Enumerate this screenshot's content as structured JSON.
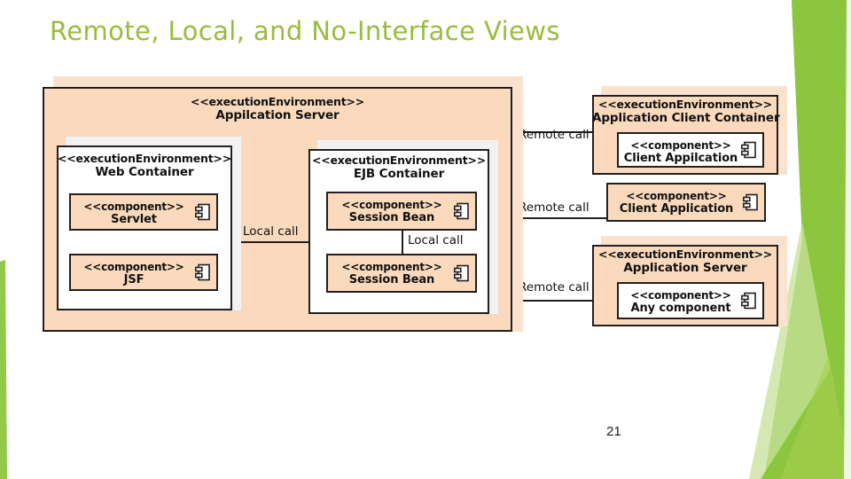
{
  "slide": {
    "title": "Remote, Local, and No-Interface Views",
    "page_number": "21",
    "title_color": "#9BBB3C",
    "node_fill": "#FAD9BC",
    "accent_green": "#8CC63E"
  },
  "diagram": {
    "type": "uml-deployment-diagram",
    "stereotype_execution_environment": "<<executionEnvironment>>",
    "stereotype_component": "<<component>>",
    "nodes": [
      {
        "id": "app-server",
        "stereotype": "<<executionEnvironment>>",
        "name": "Appilcation Server"
      },
      {
        "id": "web-container",
        "stereotype": "<<executionEnvironment>>",
        "name": "Web Container"
      },
      {
        "id": "ejb-container",
        "stereotype": "<<executionEnvironment>>",
        "name": "EJB Container"
      },
      {
        "id": "app-client-container",
        "stereotype": "<<executionEnvironment>>",
        "name": "Application Client Container"
      },
      {
        "id": "app-server-right",
        "stereotype": "<<executionEnvironment>>",
        "name": "Application Server"
      }
    ],
    "components": [
      {
        "id": "servlet",
        "stereotype": "<<component>>",
        "name": "Servlet"
      },
      {
        "id": "jsf",
        "stereotype": "<<component>>",
        "name": "JSF"
      },
      {
        "id": "session-bean-1",
        "stereotype": "<<component>>",
        "name": "Session Bean"
      },
      {
        "id": "session-bean-2",
        "stereotype": "<<component>>",
        "name": "Session Bean"
      },
      {
        "id": "client-application-contained",
        "stereotype": "<<component>>",
        "name": "Client Appilcation"
      },
      {
        "id": "client-application-standalone",
        "stereotype": "<<component>>",
        "name": "Client Application"
      },
      {
        "id": "any-component",
        "stereotype": "<<component>>",
        "name": "Any component"
      }
    ],
    "connectors": [
      {
        "id": "local-call-web-ejb",
        "label": "Local call"
      },
      {
        "id": "local-call-bean-bean",
        "label": "Local call"
      },
      {
        "id": "remote-call-client-container",
        "label": "Remote call"
      },
      {
        "id": "remote-call-client-app",
        "label": "Remote call"
      },
      {
        "id": "remote-call-app-server",
        "label": "Remote call"
      }
    ]
  }
}
